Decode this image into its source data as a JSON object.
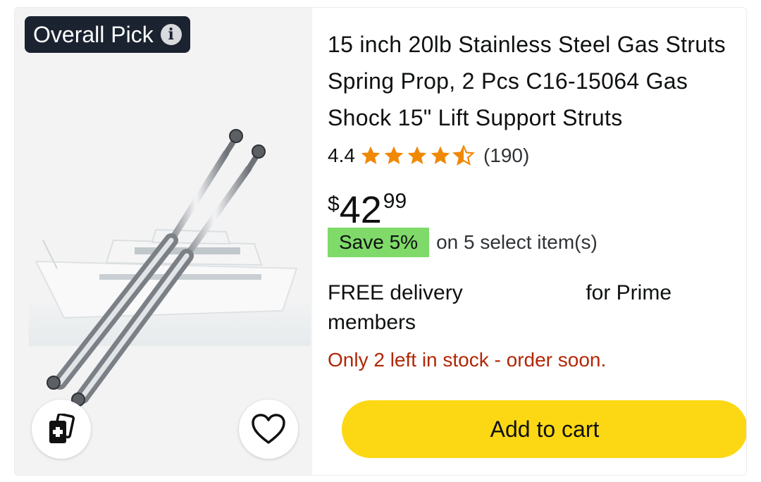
{
  "badge": {
    "label": "Overall Pick",
    "info_icon": "info-icon"
  },
  "product": {
    "title": "15 inch 20lb Stainless Steel Gas Struts Spring Prop, 2 Pcs C16-15064 Gas Shock 15\" Lift Support Struts",
    "rating_value": "4.4",
    "rating_stars": 4.5,
    "review_count": "(190)",
    "price_symbol": "$",
    "price_whole": "42",
    "price_fraction": "99",
    "save_label": "Save 5%",
    "save_detail": "on 5 select item(s)",
    "delivery_part1": "FREE delivery",
    "delivery_part2": "for Prime",
    "delivery_part3": "members",
    "stock_text": "Only 2 left in stock - order soon."
  },
  "actions": {
    "add_to_cart": "Add to cart",
    "compare_icon": "compare-icon",
    "favorite_icon": "heart-icon"
  },
  "colors": {
    "badge_bg": "#1b2330",
    "star": "#f08804",
    "save_badge": "#7fda69",
    "stock": "#b12704",
    "cart_button": "#fcd814"
  }
}
